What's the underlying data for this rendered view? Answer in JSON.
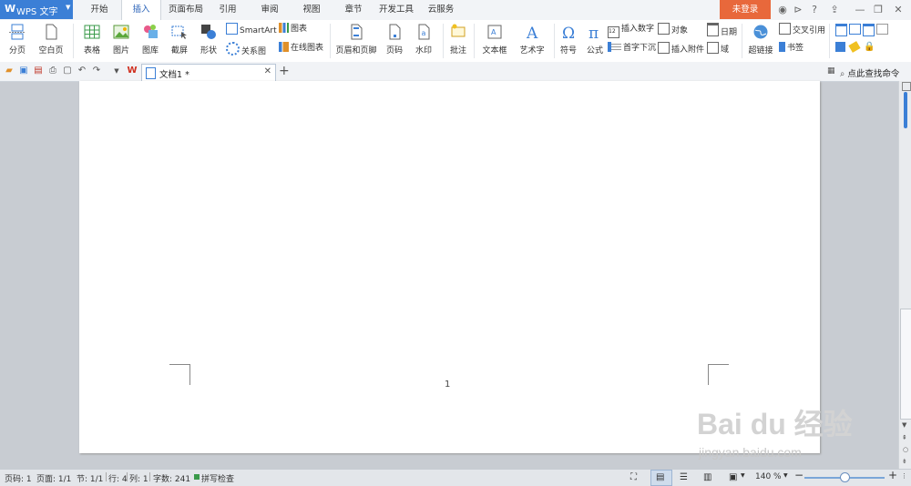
{
  "app": {
    "logo": "W",
    "name": "WPS 文字"
  },
  "menu_tabs": [
    "开始",
    "插入",
    "页面布局",
    "引用",
    "审阅",
    "视图",
    "章节",
    "开发工具",
    "云服务"
  ],
  "active_tab": "插入",
  "login_label": "未登录",
  "help_label": "?",
  "ribbon": {
    "page_break": "分页",
    "blank_page": "空白页",
    "table": "表格",
    "picture": "图片",
    "gallery": "图库",
    "screenshot": "截屏",
    "shape": "形状",
    "smartart": "SmartArt",
    "chart": "图表",
    "relation": "关系图",
    "online_chart": "在线图表",
    "header_footer": "页眉和页脚",
    "page_number": "页码",
    "watermark": "水印",
    "comment": "批注",
    "textbox": "文本框",
    "wordart": "艺术字",
    "symbol": "符号",
    "formula": "公式",
    "insert_number": "插入数字",
    "drop_cap": "首字下沉",
    "object": "对象",
    "attachment": "插入附件",
    "date": "日期",
    "field": "域",
    "hyperlink": "超链接",
    "cross_ref": "交叉引用",
    "bookmark": "书签"
  },
  "doc_tab": {
    "title": "文档1 *"
  },
  "search_cmd": "点此查找命令",
  "page_number_text": "1",
  "status": {
    "page": "页码: 1",
    "pages": "页面: 1/1",
    "section": "节: 1/1",
    "row": "行: 4",
    "col": "列: 1",
    "words": "字数: 241",
    "spell": "拼写检查",
    "zoom": "140 %"
  },
  "watermark_text": {
    "line1": "Bai du 经验",
    "line2": "jingyan.baidu.com"
  },
  "colors": {
    "accent": "#3b7fd6",
    "login": "#e8683b",
    "active_tab_text": "#2b63b8"
  }
}
